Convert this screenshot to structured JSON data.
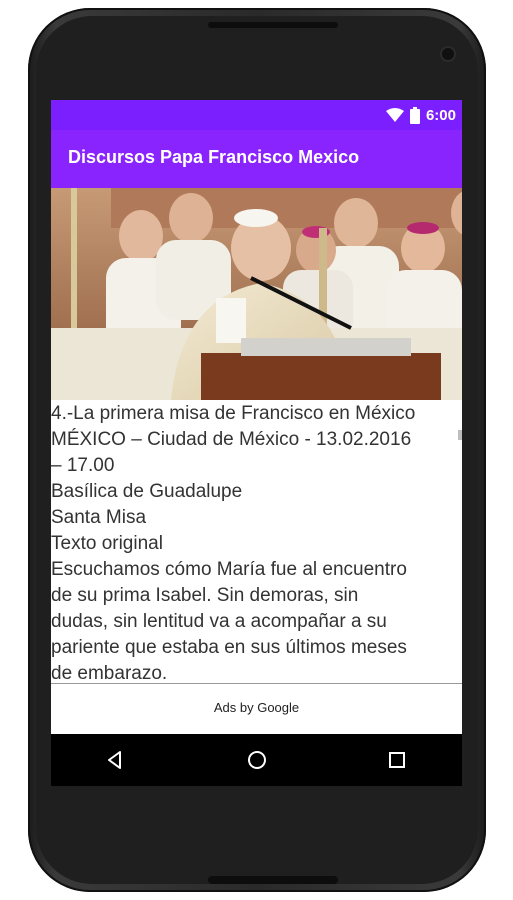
{
  "status_bar": {
    "time": "6:00",
    "icons": [
      "wifi-icon",
      "battery-icon"
    ]
  },
  "app_bar": {
    "title": "Discursos Papa Francisco Mexico"
  },
  "article": {
    "lines": [
      "4.-La primera misa de Francisco en México",
      "MÉXICO – Ciudad de México - 13.02.2016",
      "– 17.00",
      " Basílica de Guadalupe",
      " Santa Misa",
      " Texto original",
      " Escuchamos cómo María fue al encuentro",
      "de su prima Isabel. Sin demoras, sin",
      "dudas, sin lentitud va a acompañar a su",
      "pariente que estaba en sus últimos meses",
      "de embarazo."
    ]
  },
  "ad": {
    "label": "Ads by Google"
  },
  "navigation": {
    "buttons": [
      "back-icon",
      "home-icon",
      "recents-icon"
    ]
  },
  "colors": {
    "status_bar": "#7c1fff",
    "app_bar": "#8a24ff",
    "nav_bar": "#000000"
  }
}
